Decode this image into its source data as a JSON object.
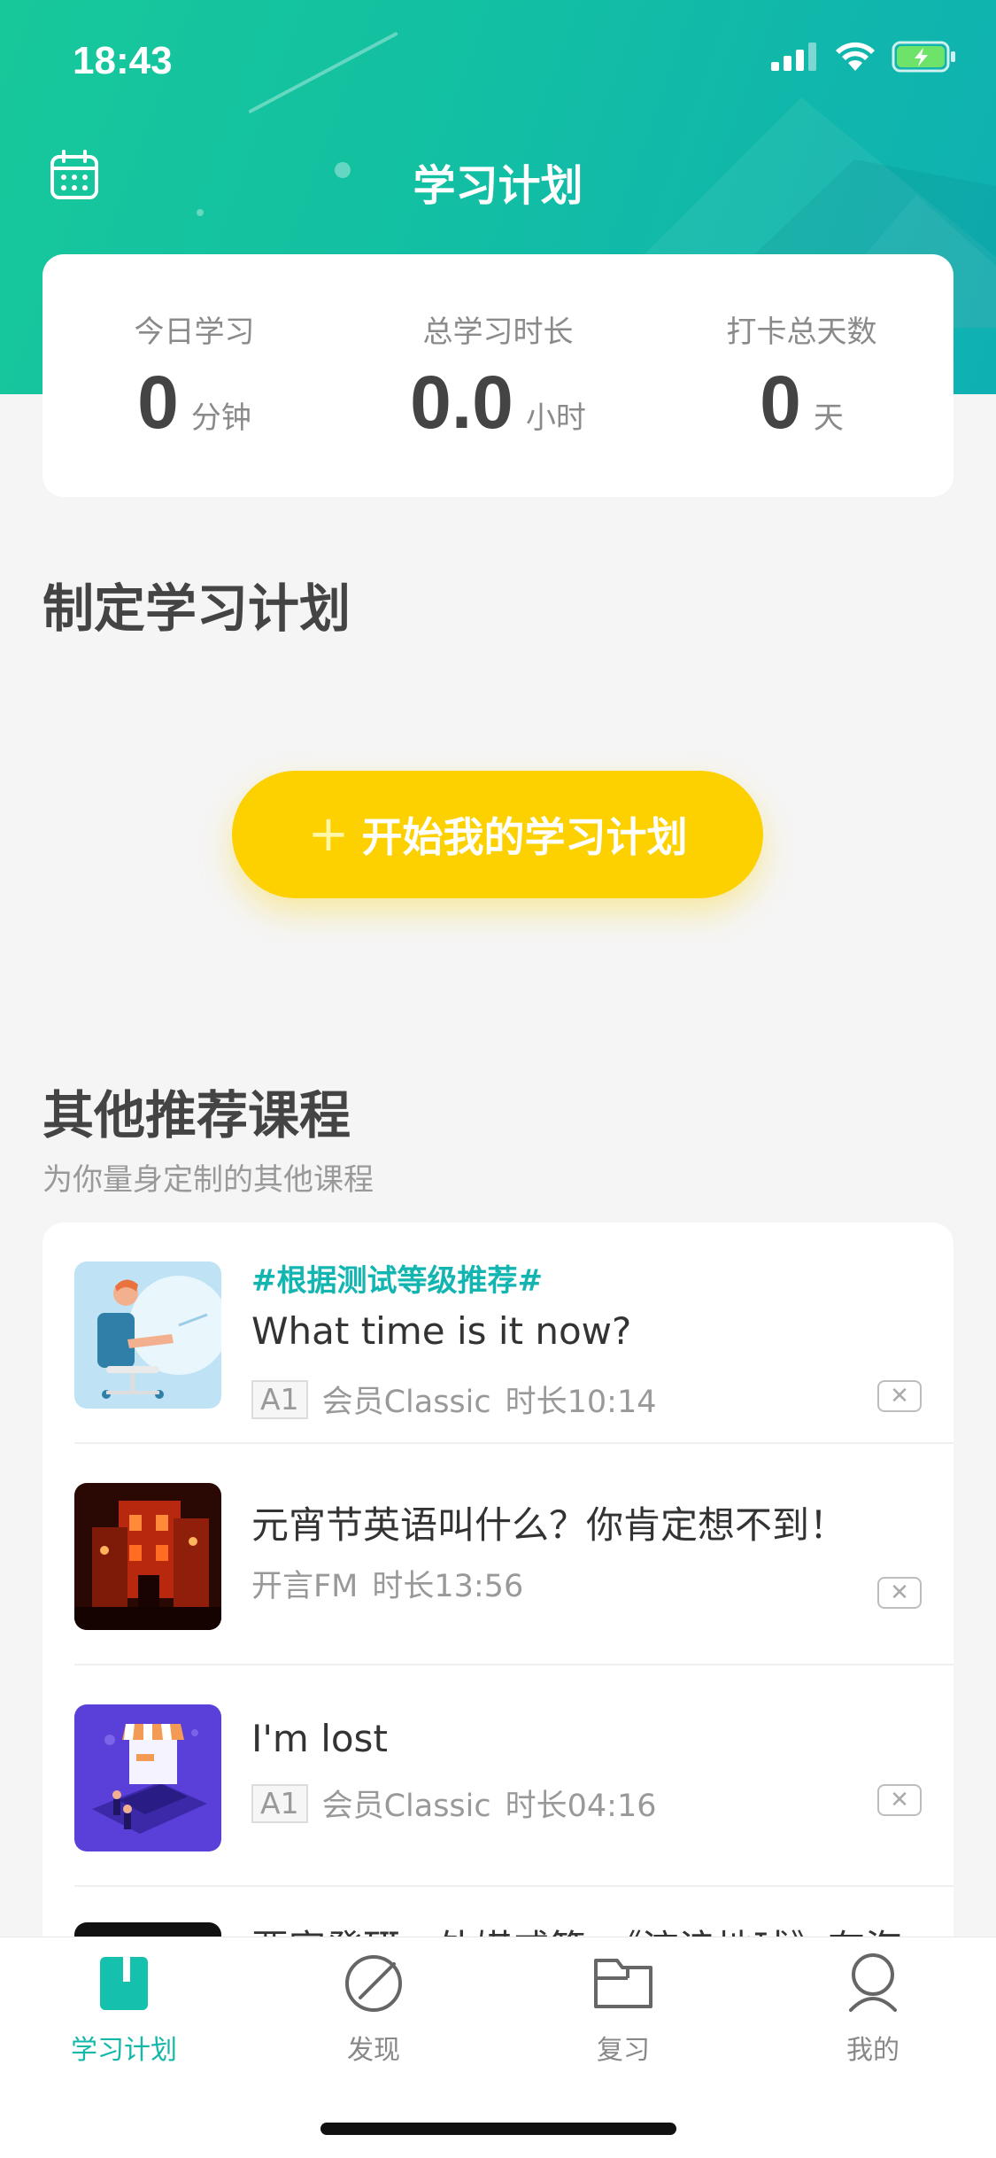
{
  "status_bar": {
    "time": "18:43"
  },
  "nav": {
    "title": "学习计划"
  },
  "stats": [
    {
      "label": "今日学习",
      "value": "0",
      "unit": "分钟"
    },
    {
      "label": "总学习时长",
      "value": "0.0",
      "unit": "小时"
    },
    {
      "label": "打卡总天数",
      "value": "0",
      "unit": "天"
    }
  ],
  "plan_section": {
    "title": "制定学习计划",
    "button_plus": "+",
    "button_label": "开始我的学习计划"
  },
  "recommend": {
    "title": "其他推荐课程",
    "subtitle": "为你量身定制的其他课程",
    "courses": [
      {
        "tag": "#根据测试等级推荐#",
        "title": "What time is it now?",
        "level": "A1",
        "source": "会员Classic",
        "duration": "时长10:14",
        "close": "✕"
      },
      {
        "tag": "",
        "title": "元宵节英语叫什么？你肯定想不到！",
        "level": "",
        "source": "开言FM",
        "duration": "时长13:56",
        "close": "✕"
      },
      {
        "tag": "",
        "title": "I'm lost",
        "level": "A1",
        "source": "会员Classic",
        "duration": "时长04:16",
        "close": "✕"
      },
      {
        "tag": "",
        "title": "要宣發硏，外媒威籍，《流浪地球》有海",
        "level": "",
        "source": "",
        "duration": "",
        "close": ""
      }
    ]
  },
  "tabbar": {
    "tabs": [
      {
        "label": "学习计划",
        "icon": "study-plan-icon",
        "active": true
      },
      {
        "label": "发现",
        "icon": "discover-icon",
        "active": false
      },
      {
        "label": "复习",
        "icon": "review-folder-icon",
        "active": false
      },
      {
        "label": "我的",
        "icon": "profile-icon",
        "active": false
      }
    ]
  },
  "colors": {
    "accent": "#13b8a8",
    "button": "#fdd000",
    "tag": "#13b5b1"
  }
}
